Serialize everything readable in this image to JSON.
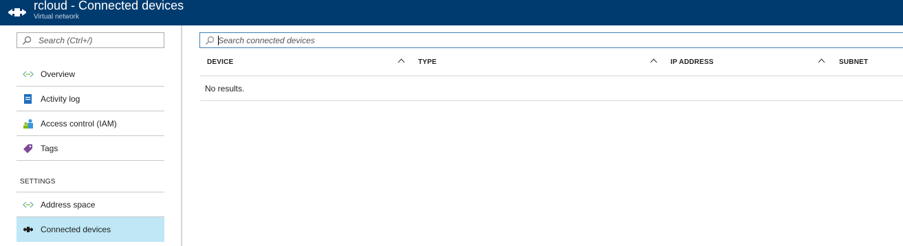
{
  "header": {
    "title": "rcloud - Connected devices",
    "subtitle": "Virtual network",
    "bg_color": "#003b6f"
  },
  "sidebar": {
    "search_placeholder": "Search (Ctrl+/)",
    "items": [
      {
        "label": "Overview",
        "icon": "vnet-arrows-icon"
      },
      {
        "label": "Activity log",
        "icon": "activity-log-icon"
      },
      {
        "label": "Access control (IAM)",
        "icon": "iam-people-icon"
      },
      {
        "label": "Tags",
        "icon": "tag-icon"
      }
    ],
    "section_label": "SETTINGS",
    "settings_items": [
      {
        "label": "Address space",
        "icon": "vnet-arrows-icon"
      },
      {
        "label": "Connected devices",
        "icon": "connected-devices-icon",
        "selected": true
      }
    ],
    "selected_color": "#bfe7f5"
  },
  "main": {
    "search_placeholder": "Search connected devices",
    "columns": [
      "DEVICE",
      "TYPE",
      "IP ADDRESS",
      "SUBNET"
    ],
    "empty_text": "No results."
  }
}
